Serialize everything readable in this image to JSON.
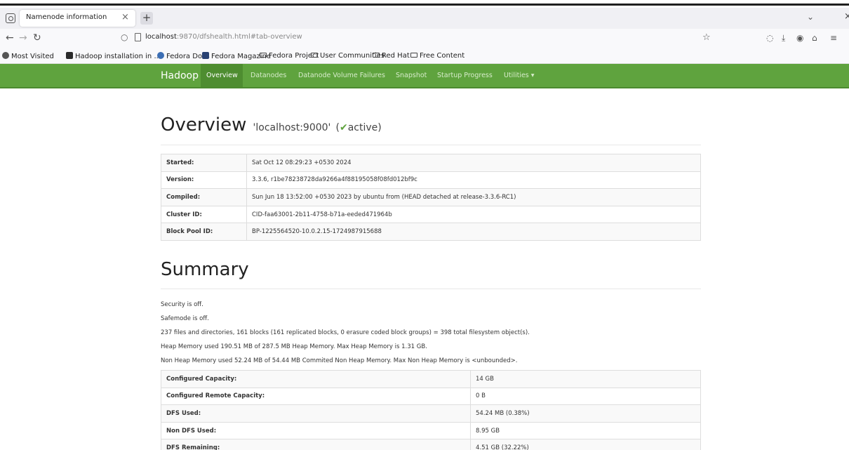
{
  "browser": {
    "tab_title": "Namenode information",
    "tab_close": "×",
    "new_tab": "+",
    "url_host": "localhost",
    "url_rest": ":9870/dfshealth.html#tab-overview",
    "bookmarks": [
      {
        "label": "Most Visited",
        "icon": "gear-icon",
        "color": "#555555"
      },
      {
        "label": "Hadoop installation in ...",
        "icon": "site-icon",
        "color": "#2b2b2b"
      },
      {
        "label": "Fedora Docs",
        "icon": "fedora-icon",
        "color": "#3c6eb4"
      },
      {
        "label": "Fedora Magazine",
        "icon": "magazine-icon",
        "color": "#294172"
      },
      {
        "label": "Fedora Project",
        "icon": "folder-icon"
      },
      {
        "label": "User Communities",
        "icon": "folder-icon"
      },
      {
        "label": "Red Hat",
        "icon": "folder-icon"
      },
      {
        "label": "Free Content",
        "icon": "folder-icon"
      }
    ]
  },
  "hadoop_nav": {
    "brand": "Hadoop",
    "items": [
      "Overview",
      "Datanodes",
      "Datanode Volume Failures",
      "Snapshot",
      "Startup Progress",
      "Utilities ▾"
    ],
    "active_index": 0,
    "accent": "#5fa33e"
  },
  "overview": {
    "title": "Overview",
    "host": "'localhost:9000'",
    "status_open": "(",
    "status_check": "✔",
    "status_text": "active)",
    "rows": [
      {
        "key": "Started:",
        "value": "Sat Oct 12 08:29:23 +0530 2024"
      },
      {
        "key": "Version:",
        "value": "3.3.6, r1be78238728da9266a4f88195058f08fd012bf9c"
      },
      {
        "key": "Compiled:",
        "value": "Sun Jun 18 13:52:00 +0530 2023 by ubuntu from (HEAD detached at release-3.3.6-RC1)"
      },
      {
        "key": "Cluster ID:",
        "value": "CID-faa63001-2b11-4758-b71a-eeded471964b"
      },
      {
        "key": "Block Pool ID:",
        "value": "BP-1225564520-10.0.2.15-1724987915688"
      }
    ]
  },
  "summary": {
    "title": "Summary",
    "lines": [
      "Security is off.",
      "Safemode is off.",
      "237 files and directories, 161 blocks (161 replicated blocks, 0 erasure coded block groups) = 398 total filesystem object(s).",
      "Heap Memory used 190.51 MB of 287.5 MB Heap Memory. Max Heap Memory is 1.31 GB.",
      "Non Heap Memory used 52.24 MB of 54.44 MB Commited Non Heap Memory. Max Non Heap Memory is <unbounded>."
    ],
    "rows": [
      {
        "key": "Configured Capacity:",
        "value": "14 GB"
      },
      {
        "key": "Configured Remote Capacity:",
        "value": "0 B"
      },
      {
        "key": "DFS Used:",
        "value": "54.24 MB (0.38%)"
      },
      {
        "key": "Non DFS Used:",
        "value": "8.95 GB"
      },
      {
        "key": "DFS Remaining:",
        "value": "4.51 GB (32.22%)"
      }
    ]
  }
}
